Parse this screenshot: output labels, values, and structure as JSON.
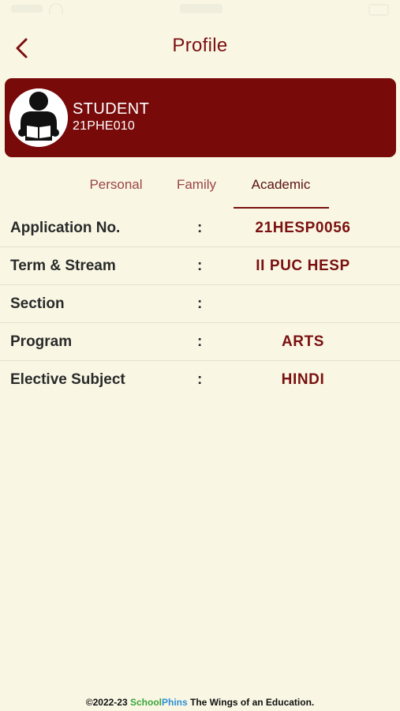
{
  "header": {
    "title": "Profile",
    "back_icon": "chevron-left-icon"
  },
  "profile": {
    "name": "STUDENT",
    "id": "21PHE010",
    "avatar_icon": "student-reading-avatar-icon"
  },
  "tabs": [
    {
      "label": "Personal",
      "active": false
    },
    {
      "label": "Family",
      "active": false
    },
    {
      "label": "Academic",
      "active": true
    }
  ],
  "academic": {
    "separator": ":",
    "rows": [
      {
        "label": "Application No.",
        "value": "21HESP0056"
      },
      {
        "label": "Term & Stream",
        "value": "II PUC HESP"
      },
      {
        "label": "Section",
        "value": ""
      },
      {
        "label": "Program",
        "value": "ARTS"
      },
      {
        "label": "Elective Subject",
        "value": "HINDI"
      }
    ]
  },
  "footer": {
    "copyright": "©2022-23",
    "brand_school": "School",
    "brand_phins": "Phins",
    "tagline": "The Wings of an Education."
  },
  "colors": {
    "background": "#f9f7e4",
    "primary": "#780a0a",
    "accent_text": "#7a1010"
  }
}
